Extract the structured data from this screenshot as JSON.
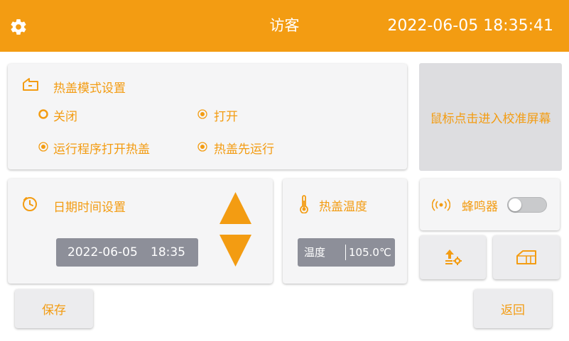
{
  "header": {
    "title": "访客",
    "datetime": "2022-06-05 18:35:41",
    "settings_icon": "gear-icon"
  },
  "lid_mode": {
    "title": "热盖模式设置",
    "icon": "lid-icon",
    "options": [
      {
        "label": "关闭",
        "selected": true
      },
      {
        "label": "打开",
        "selected": false
      },
      {
        "label": "运行程序打开热盖",
        "selected": false
      },
      {
        "label": "热盖先运行",
        "selected": false
      }
    ]
  },
  "calibration": {
    "label": "鼠标点击进入校准屏幕"
  },
  "datetime_settings": {
    "title": "日期时间设置",
    "icon": "clock-icon",
    "date": "2022-06-05",
    "time": "18:35",
    "up_icon": "triangle-up-icon",
    "down_icon": "triangle-down-icon"
  },
  "lid_temperature": {
    "title": "热盖温度",
    "icon": "thermometer-icon",
    "field_label": "温度",
    "value": "105.0℃"
  },
  "buzzer": {
    "label": "蜂鸣器",
    "icon": "buzzer-icon",
    "enabled": false
  },
  "tools": {
    "upgrade_icon": "upgrade-settings-icon",
    "home_icon": "home-icon"
  },
  "buttons": {
    "save": "保存",
    "back": "返回"
  },
  "colors": {
    "accent": "#f39c12",
    "panel": "#f5f5f6",
    "field": "#8d8f99"
  }
}
